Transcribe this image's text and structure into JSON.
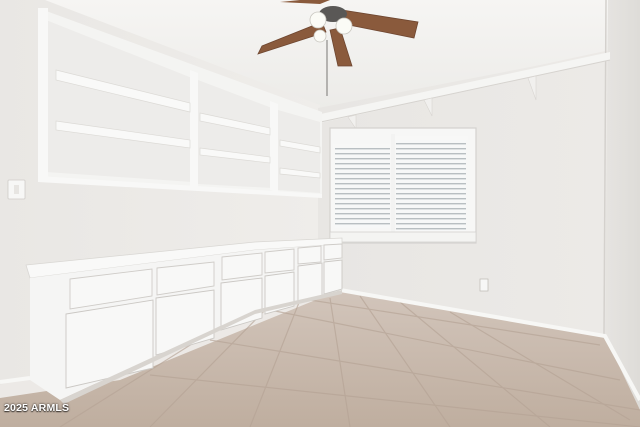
{
  "scene": {
    "description_free": true
  },
  "watermark": {
    "text": "2025 ARMLS"
  },
  "colors": {
    "wall": "#eceae8",
    "ceiling": "#f3f2f0",
    "cabinet": "#f7f7f6",
    "floor_tile": "#c9b9ad",
    "fan_blade": "#8a5a3c"
  }
}
